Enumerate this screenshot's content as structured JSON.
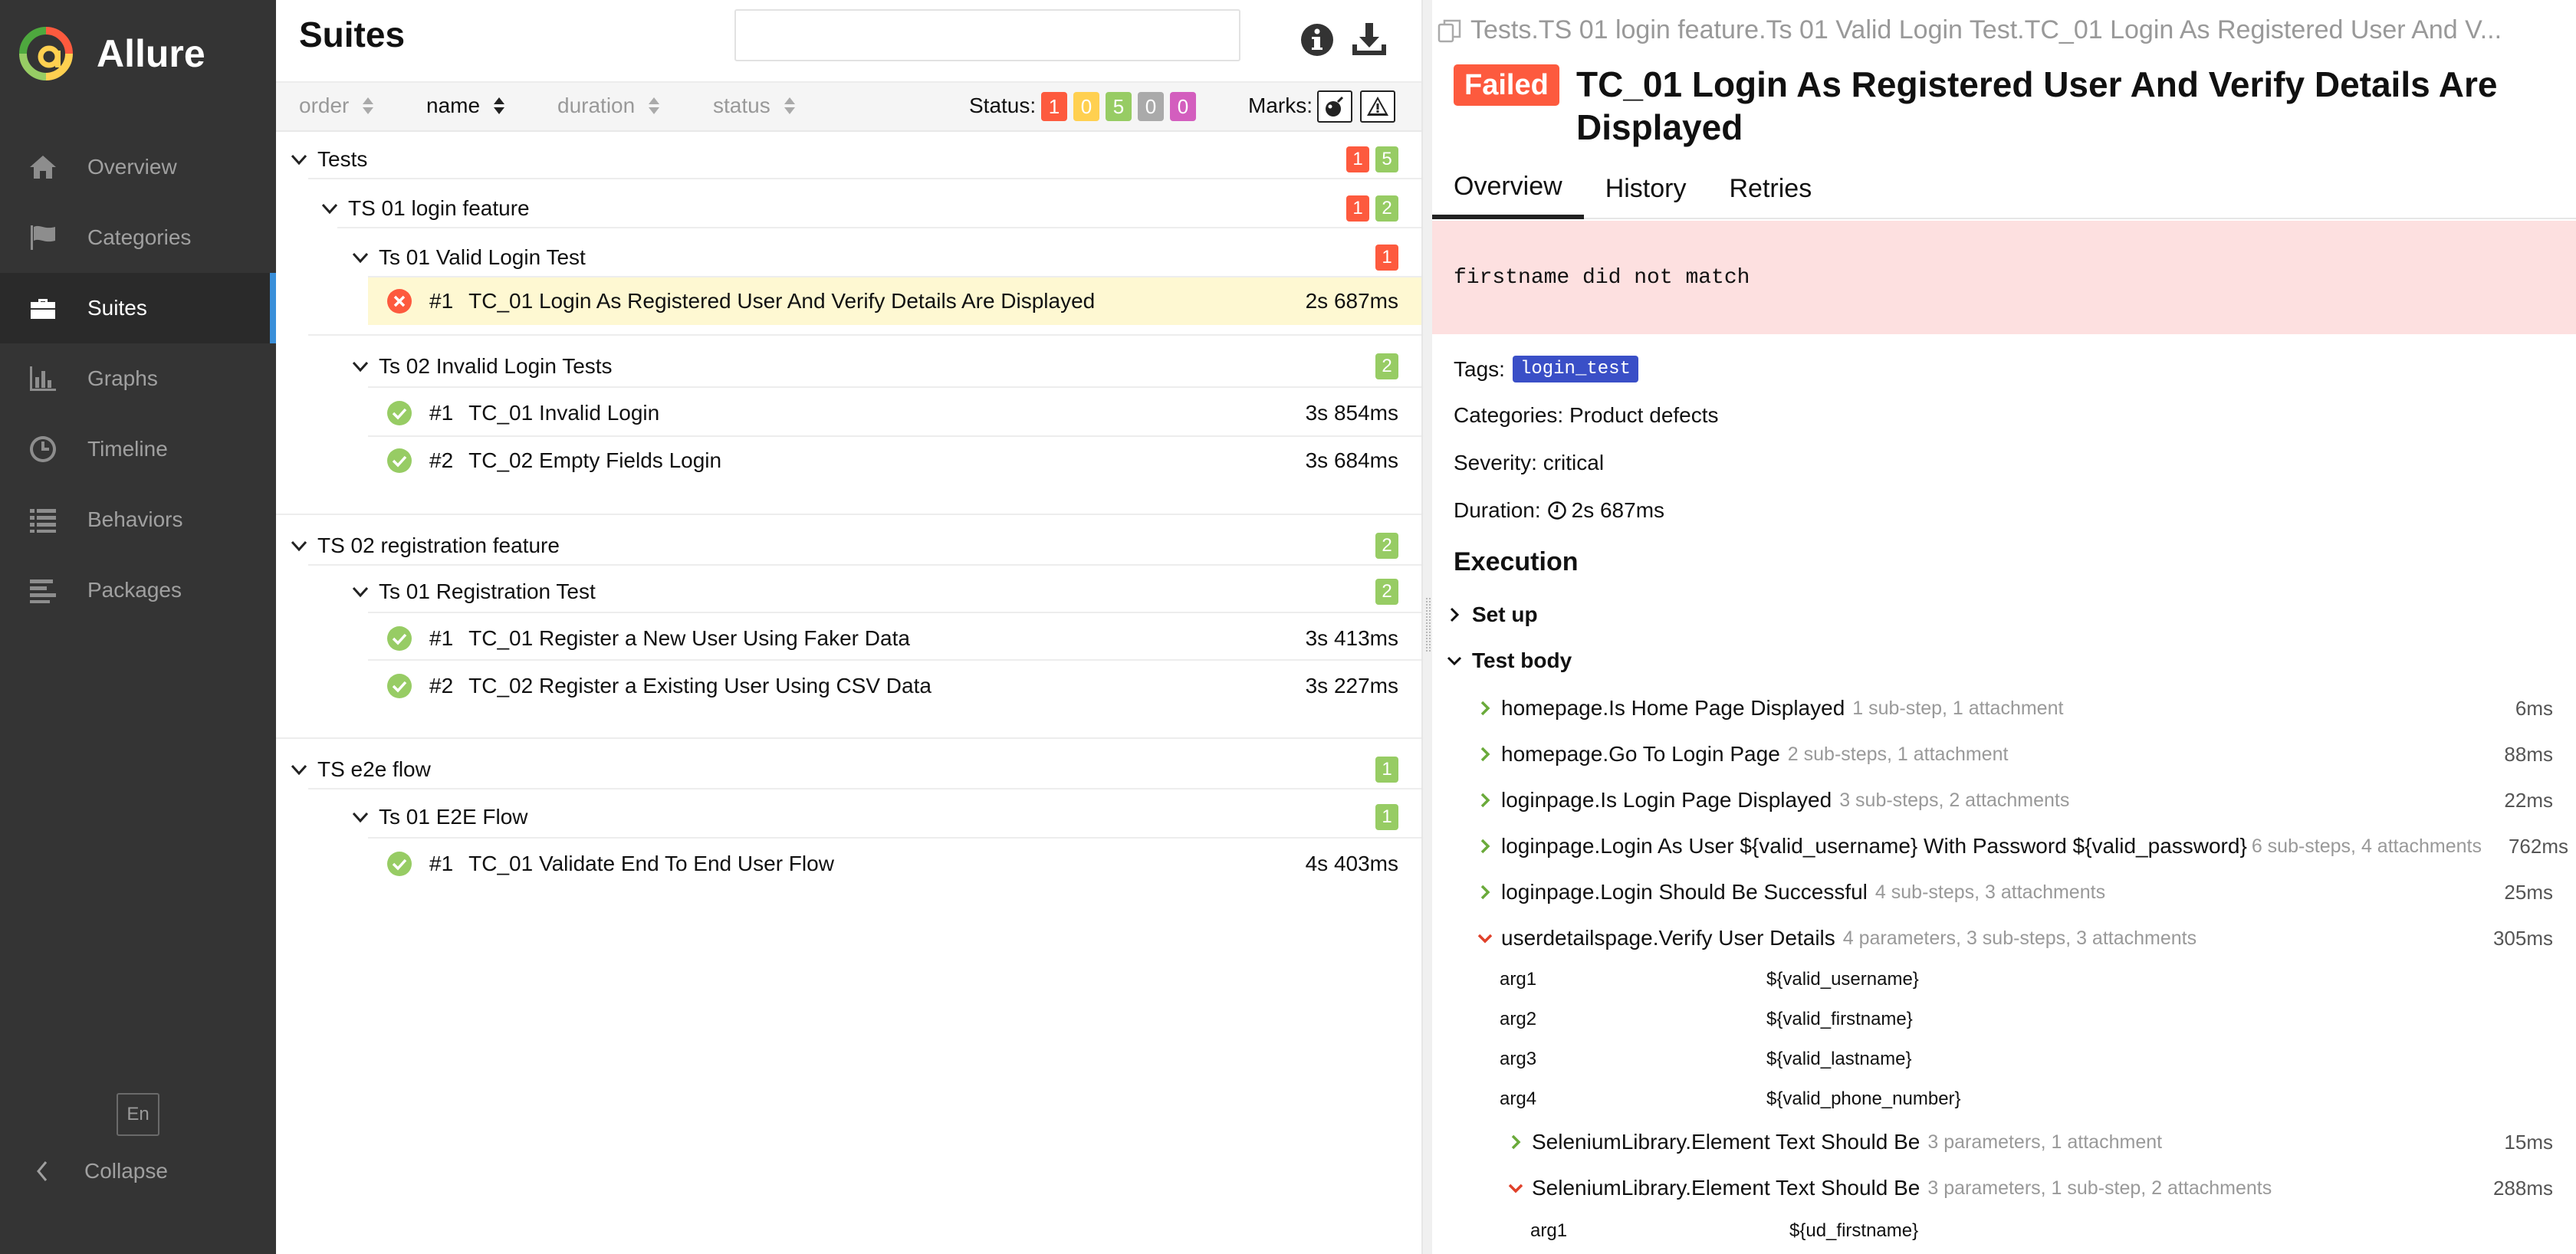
{
  "app": {
    "name": "Allure"
  },
  "sidebar": {
    "items": [
      {
        "label": "Overview",
        "icon": "home-icon"
      },
      {
        "label": "Categories",
        "icon": "flag-icon"
      },
      {
        "label": "Suites",
        "icon": "briefcase-icon",
        "active": true
      },
      {
        "label": "Graphs",
        "icon": "bar-chart-icon"
      },
      {
        "label": "Timeline",
        "icon": "clock-icon"
      },
      {
        "label": "Behaviors",
        "icon": "list-icon"
      },
      {
        "label": "Packages",
        "icon": "align-left-icon"
      }
    ],
    "lang": "En",
    "collapse": "Collapse"
  },
  "suites": {
    "title": "Suites",
    "search_value": "",
    "sort": {
      "order": "order",
      "name": "name",
      "duration": "duration",
      "status": "status"
    },
    "status_label": "Status:",
    "status_counts": {
      "failed": "1",
      "broken": "0",
      "passed": "5",
      "skipped": "0",
      "unknown": "0"
    },
    "marks_label": "Marks:",
    "tree": {
      "root": {
        "name": "Tests",
        "failed": "1",
        "passed": "5"
      },
      "g1": {
        "name": "TS 01 login feature",
        "failed": "1",
        "passed": "2"
      },
      "g1s1": {
        "name": "Ts 01 Valid Login Test",
        "failed": "1"
      },
      "g1s1t1": {
        "num": "#1",
        "name": "TC_01 Login As Registered User And Verify Details Are Displayed",
        "duration": "2s 687ms"
      },
      "g1s2": {
        "name": "Ts 02 Invalid Login Tests",
        "passed": "2"
      },
      "g1s2t1": {
        "num": "#1",
        "name": "TC_01 Invalid Login",
        "duration": "3s 854ms"
      },
      "g1s2t2": {
        "num": "#2",
        "name": "TC_02 Empty Fields Login",
        "duration": "3s 684ms"
      },
      "g2": {
        "name": "TS 02 registration feature",
        "passed": "2"
      },
      "g2s1": {
        "name": "Ts 01 Registration Test",
        "passed": "2"
      },
      "g2s1t1": {
        "num": "#1",
        "name": "TC_01 Register a New User Using Faker Data",
        "duration": "3s 413ms"
      },
      "g2s1t2": {
        "num": "#2",
        "name": "TC_02 Register a Existing User Using CSV Data",
        "duration": "3s 227ms"
      },
      "g3": {
        "name": "TS e2e flow",
        "passed": "1"
      },
      "g3s1": {
        "name": "Ts 01 E2E Flow",
        "passed": "1"
      },
      "g3s1t1": {
        "num": "#1",
        "name": "TC_01 Validate End To End User Flow",
        "duration": "4s 403ms"
      }
    }
  },
  "detail": {
    "breadcrumb": "Tests.TS 01 login feature.Ts 01 Valid Login Test.TC_01 Login As Registered User And V...",
    "status": "Failed",
    "title": "TC_01 Login As Registered User And Verify Details Are Displayed",
    "tabs": [
      "Overview",
      "History",
      "Retries"
    ],
    "error": "firstname did not match",
    "tags_label": "Tags:",
    "tag": "login_test",
    "categories": "Categories: Product defects",
    "severity": "Severity: critical",
    "duration_label": "Duration:",
    "duration": "2s 687ms",
    "execution": "Execution",
    "setup": "Set up",
    "test_body": "Test body",
    "steps": [
      {
        "name": "homepage.Is Home Page Displayed",
        "meta": "1 sub-step, 1 attachment",
        "dur": "6ms"
      },
      {
        "name": "homepage.Go To Login Page",
        "meta": "2 sub-steps, 1 attachment",
        "dur": "88ms"
      },
      {
        "name": "loginpage.Is Login Page Displayed",
        "meta": "3 sub-steps, 2 attachments",
        "dur": "22ms"
      },
      {
        "name": "loginpage.Login As User ${valid_username} With Password ${valid_password}",
        "meta": "6 sub-steps, 4 attachments",
        "dur": "762ms"
      },
      {
        "name": "loginpage.Login Should Be Successful",
        "meta": "4 sub-steps, 3 attachments",
        "dur": "25ms"
      },
      {
        "name": "userdetailspage.Verify User Details",
        "meta": "4 parameters, 3 sub-steps, 3 attachments",
        "dur": "305ms"
      }
    ],
    "params": [
      {
        "name": "arg1",
        "value": "${valid_username}"
      },
      {
        "name": "arg2",
        "value": "${valid_firstname}"
      },
      {
        "name": "arg3",
        "value": "${valid_lastname}"
      },
      {
        "name": "arg4",
        "value": "${valid_phone_number}"
      }
    ],
    "substeps": [
      {
        "name": "SeleniumLibrary.Element Text Should Be",
        "meta": "3 parameters, 1 attachment",
        "dur": "15ms"
      },
      {
        "name": "SeleniumLibrary.Element Text Should Be",
        "meta": "3 parameters, 1 sub-step, 2 attachments",
        "dur": "288ms"
      }
    ],
    "subparam": {
      "name": "arg1",
      "value": "${ud_firstname}"
    }
  },
  "colors": {
    "failed": "#fd5a3e",
    "broken": "#ffd050",
    "passed": "#97cc64",
    "skipped": "#aaaaaa",
    "unknown": "#d35ebe",
    "sidebar": "#343434",
    "active_accent": "#3a8fd9",
    "selected_row": "#fef8d2",
    "tag": "#3a4fc7"
  }
}
